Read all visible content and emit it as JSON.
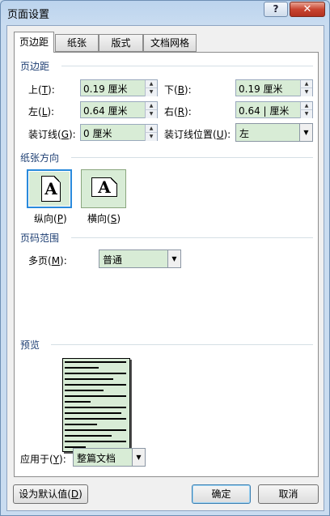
{
  "window": {
    "title": "页面设置",
    "help_label": "?",
    "close_label": "✕"
  },
  "tabs": [
    {
      "label": "页边距",
      "active": true
    },
    {
      "label": "纸张",
      "active": false
    },
    {
      "label": "版式",
      "active": false
    },
    {
      "label": "文档网格",
      "active": false
    }
  ],
  "margins": {
    "section_title": "页边距",
    "top": {
      "label": "上(",
      "key": "T",
      "end": "):",
      "value": "0.19 厘米"
    },
    "bottom": {
      "label": "下(",
      "key": "B",
      "end": "):",
      "value": "0.19 厘米"
    },
    "left": {
      "label": "左(",
      "key": "L",
      "end": "):",
      "value": "0.64 厘米"
    },
    "right": {
      "label": "右(",
      "key": "R",
      "end": "):",
      "value": "0.64 | 厘米"
    },
    "gutter": {
      "label": "装订线(",
      "key": "G",
      "end": "):",
      "value": "0 厘米"
    },
    "gutter_pos": {
      "label": "装订线位置(",
      "key": "U",
      "end": "):",
      "value": "左"
    }
  },
  "orientation": {
    "section_title": "纸张方向",
    "portrait": {
      "label": "纵向(",
      "key": "P",
      "end": ")",
      "glyph": "A"
    },
    "landscape": {
      "label": "横向(",
      "key": "S",
      "end": ")",
      "glyph": "A"
    }
  },
  "pages": {
    "section_title": "页码范围",
    "multiple": {
      "label": "多页(",
      "key": "M",
      "end": "):",
      "value": "普通"
    }
  },
  "preview": {
    "section_title": "预览",
    "apply_to": {
      "label": "应用于(",
      "key": "Y",
      "end": "):",
      "value": "整篇文档"
    }
  },
  "footer": {
    "default_btn": {
      "label": "设为默认值(",
      "key": "D",
      "end": ")"
    },
    "ok_label": "确定",
    "cancel_label": "取消"
  },
  "icons": {
    "spin_up": "up-triangle",
    "spin_down": "down-triangle",
    "combo_arrow": "down-triangle"
  }
}
